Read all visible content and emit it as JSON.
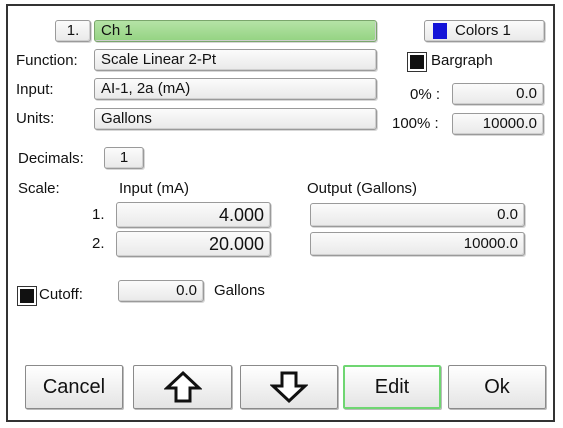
{
  "header": {
    "channel_number": "1.",
    "channel_name": "Ch 1",
    "colors_label": "Colors 1",
    "colors_swatch_color": "#1414d8"
  },
  "function": {
    "label": "Function:",
    "value": "Scale Linear 2-Pt"
  },
  "input": {
    "label": "Input:",
    "value": "AI-1, 2a (mA)"
  },
  "units": {
    "label": "Units:",
    "value": "Gallons"
  },
  "bargraph": {
    "label": "Bargraph",
    "checked": true,
    "zero_label": "0% :",
    "zero_value": "0.0",
    "full_label": "100% :",
    "full_value": "10000.0"
  },
  "decimals": {
    "label": "Decimals:",
    "value": "1"
  },
  "scale": {
    "label": "Scale:",
    "input_header": "Input (mA)",
    "output_header": "Output (Gallons)",
    "rows": [
      {
        "index": "1.",
        "input": "4.000",
        "output": "0.0"
      },
      {
        "index": "2.",
        "input": "20.000",
        "output": "10000.0"
      }
    ]
  },
  "cutoff": {
    "label": "Cutoff:",
    "checked": true,
    "value": "0.0",
    "units": "Gallons"
  },
  "buttons": {
    "cancel": "Cancel",
    "up_icon": "up-arrow-icon",
    "down_icon": "down-arrow-icon",
    "edit": "Edit",
    "ok": "Ok",
    "edit_border_color": "#6fd672"
  }
}
